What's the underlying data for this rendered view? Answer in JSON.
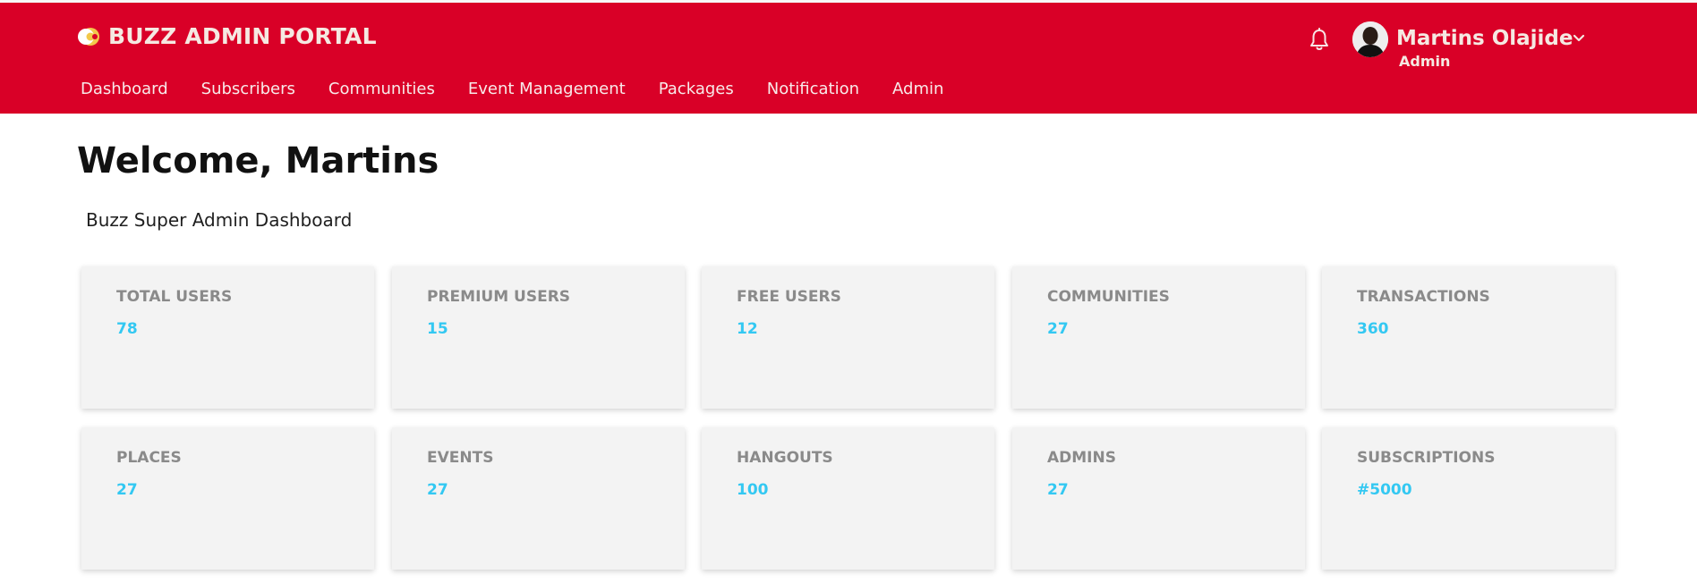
{
  "header": {
    "brand_title": "BUZZ ADMIN PORTAL",
    "brand_color": "#d90027",
    "nav": [
      {
        "label": "Dashboard"
      },
      {
        "label": "Subscribers"
      },
      {
        "label": "Communities"
      },
      {
        "label": "Event Management"
      },
      {
        "label": "Packages"
      },
      {
        "label": "Notification"
      },
      {
        "label": "Admin"
      }
    ],
    "user": {
      "name": "Martins Olajide",
      "role": "Admin"
    }
  },
  "main": {
    "welcome": "Welcome, Martins",
    "subtitle": "Buzz Super Admin Dashboard",
    "stats": [
      {
        "label": "TOTAL USERS",
        "value": "78"
      },
      {
        "label": "PREMIUM USERS",
        "value": "15"
      },
      {
        "label": "FREE USERS",
        "value": "12"
      },
      {
        "label": "COMMUNITIES",
        "value": "27"
      },
      {
        "label": "TRANSACTIONS",
        "value": "360"
      },
      {
        "label": "PLACES",
        "value": "27"
      },
      {
        "label": "EVENTS",
        "value": "27"
      },
      {
        "label": "HANGOUTS",
        "value": "100"
      },
      {
        "label": "ADMINS",
        "value": "27"
      },
      {
        "label": "SUBSCRIPTIONS",
        "value": "#5000"
      }
    ],
    "value_color": "#33c8f2"
  }
}
